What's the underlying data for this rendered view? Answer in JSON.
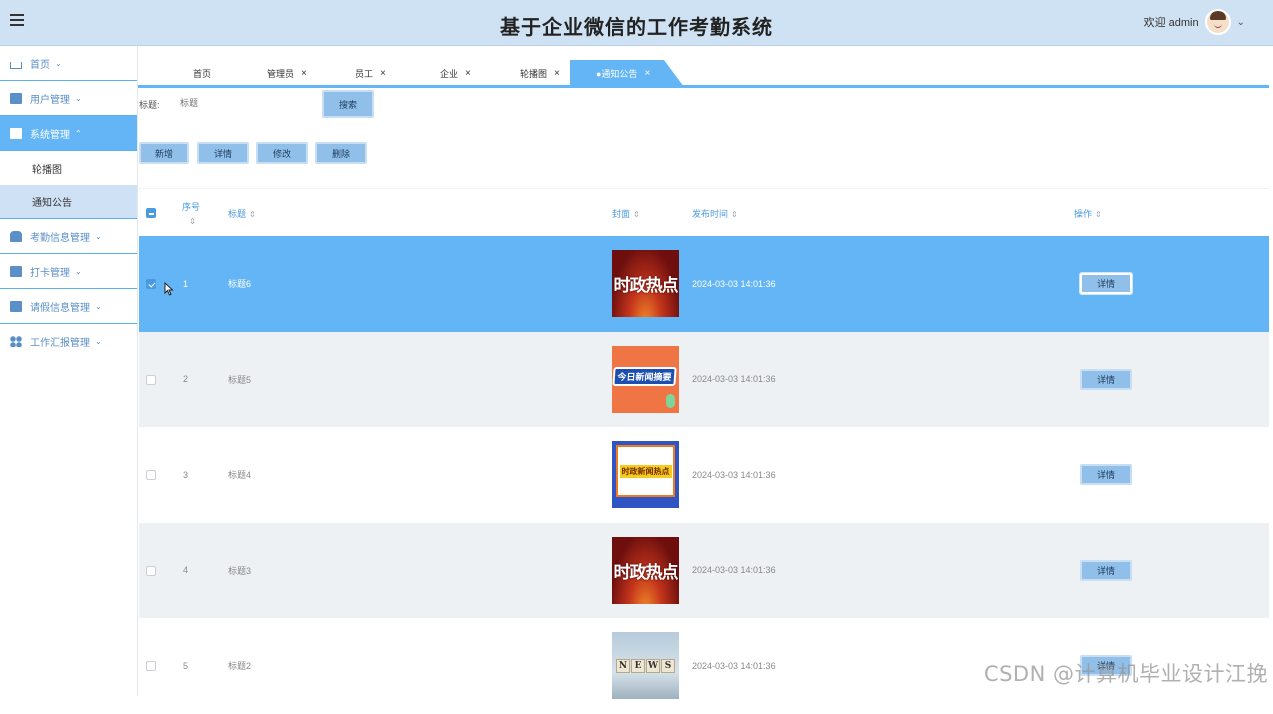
{
  "header": {
    "title": "基于企业微信的工作考勤系统",
    "welcome": "欢迎 admin",
    "caret": "⌄"
  },
  "sidebar": {
    "items": [
      {
        "label": "首页",
        "icon": "home-icon",
        "chevron": "⌄"
      },
      {
        "label": "用户管理",
        "icon": "user-manage-icon",
        "chevron": "⌄"
      },
      {
        "label": "系统管理",
        "icon": "system-icon",
        "chevron": "⌃",
        "active": true
      },
      {
        "label": "考勤信息管理",
        "icon": "attendance-icon",
        "chevron": "⌄"
      },
      {
        "label": "打卡管理",
        "icon": "clock-in-icon",
        "chevron": "⌄"
      },
      {
        "label": "请假信息管理",
        "icon": "leave-icon",
        "chevron": "⌄"
      },
      {
        "label": "工作汇报管理",
        "icon": "report-grid-icon",
        "chevron": "⌄"
      }
    ],
    "sub_items": [
      {
        "label": "轮播图"
      },
      {
        "label": "通知公告",
        "active": true
      }
    ]
  },
  "tabs": [
    {
      "label": "首页"
    },
    {
      "label": "管理员",
      "close": "×"
    },
    {
      "label": "员工",
      "close": "×"
    },
    {
      "label": "企业",
      "close": "×"
    },
    {
      "label": "轮播图",
      "close": "×"
    },
    {
      "label": "●通知公告",
      "close": "×",
      "active": true
    }
  ],
  "search": {
    "label": "标题:",
    "placeholder": "标题",
    "button": "搜索"
  },
  "toolbar": {
    "add": "新增",
    "detail": "详情",
    "edit": "修改",
    "delete": "删除"
  },
  "table": {
    "columns": {
      "index": "序号",
      "title": "标题",
      "cover": "封面",
      "time": "发布时间",
      "action": "操作"
    },
    "sort_glyph": "⇕",
    "rows": [
      {
        "index": "1",
        "title": "标题6",
        "cover": "时政热点",
        "time": "2024-03-03 14:01:36",
        "action": "详情",
        "selected": true
      },
      {
        "index": "2",
        "title": "标题5",
        "cover": "今日新闻摘要",
        "time": "2024-03-03 14:01:36",
        "action": "详情"
      },
      {
        "index": "3",
        "title": "标题4",
        "cover": "时政新闻热点",
        "time": "2024-03-03 14:01:36",
        "action": "详情"
      },
      {
        "index": "4",
        "title": "标题3",
        "cover": "时政热点",
        "time": "2024-03-03 14:01:36",
        "action": "详情"
      },
      {
        "index": "5",
        "title": "标题2",
        "cover": "NEWS",
        "time": "2024-03-03 14:01:36",
        "action": "详情"
      }
    ]
  },
  "watermark": "CSDN @计算机毕业设计江挽"
}
